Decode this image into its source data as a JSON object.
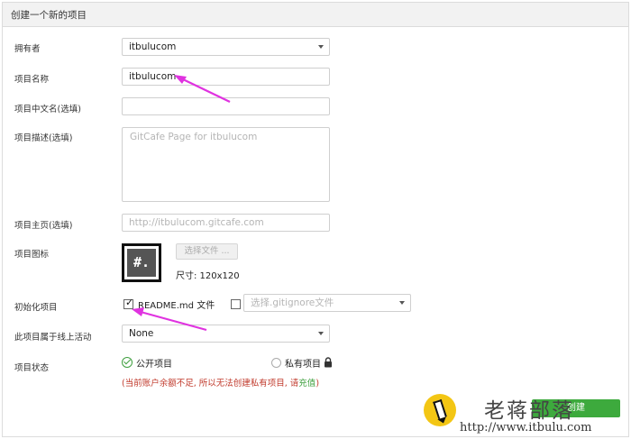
{
  "header": {
    "title": "创建一个新的项目"
  },
  "form": {
    "owner": {
      "label": "拥有者",
      "value": "itbulucom"
    },
    "name": {
      "label": "项目名称",
      "value": "itbulucom"
    },
    "cn_name": {
      "label": "项目中文名(选填)",
      "value": ""
    },
    "description": {
      "label": "项目描述(选填)",
      "placeholder": "GitCafe Page for itbulucom"
    },
    "homepage": {
      "label": "项目主页(选填)",
      "placeholder": "http://itbulucom.gitcafe.com"
    },
    "icon": {
      "label": "项目图标",
      "avatar_text": "#.",
      "file_button": "选择文件 ...",
      "size_text": "尺寸: 120x120"
    },
    "init": {
      "label": "初始化项目",
      "readme_label": "README.md 文件",
      "readme_checked": true,
      "gitignore_checked": false,
      "gitignore_placeholder": "选择.gitignore文件"
    },
    "activity": {
      "label": "此项目属于线上活动",
      "value": "None"
    },
    "status": {
      "label": "项目状态",
      "public_label": "公开项目",
      "private_label": "私有项目",
      "selected": "public"
    },
    "warning": {
      "text": "(当前账户余额不足, 所以无法创建私有项目, 请",
      "link": "充值",
      "suffix": ")"
    },
    "submit_label": "创建"
  },
  "watermark": {
    "title": "老蒋部落",
    "url": "http://www.itbulu.com"
  },
  "colors": {
    "accent_green": "#3daa3d",
    "warning_red": "#c0392b",
    "annotation_arrow": "#e033e0"
  },
  "icons": [
    "dropdown-caret-icon",
    "lock-icon",
    "check-circle-icon",
    "pen-logo-icon"
  ]
}
